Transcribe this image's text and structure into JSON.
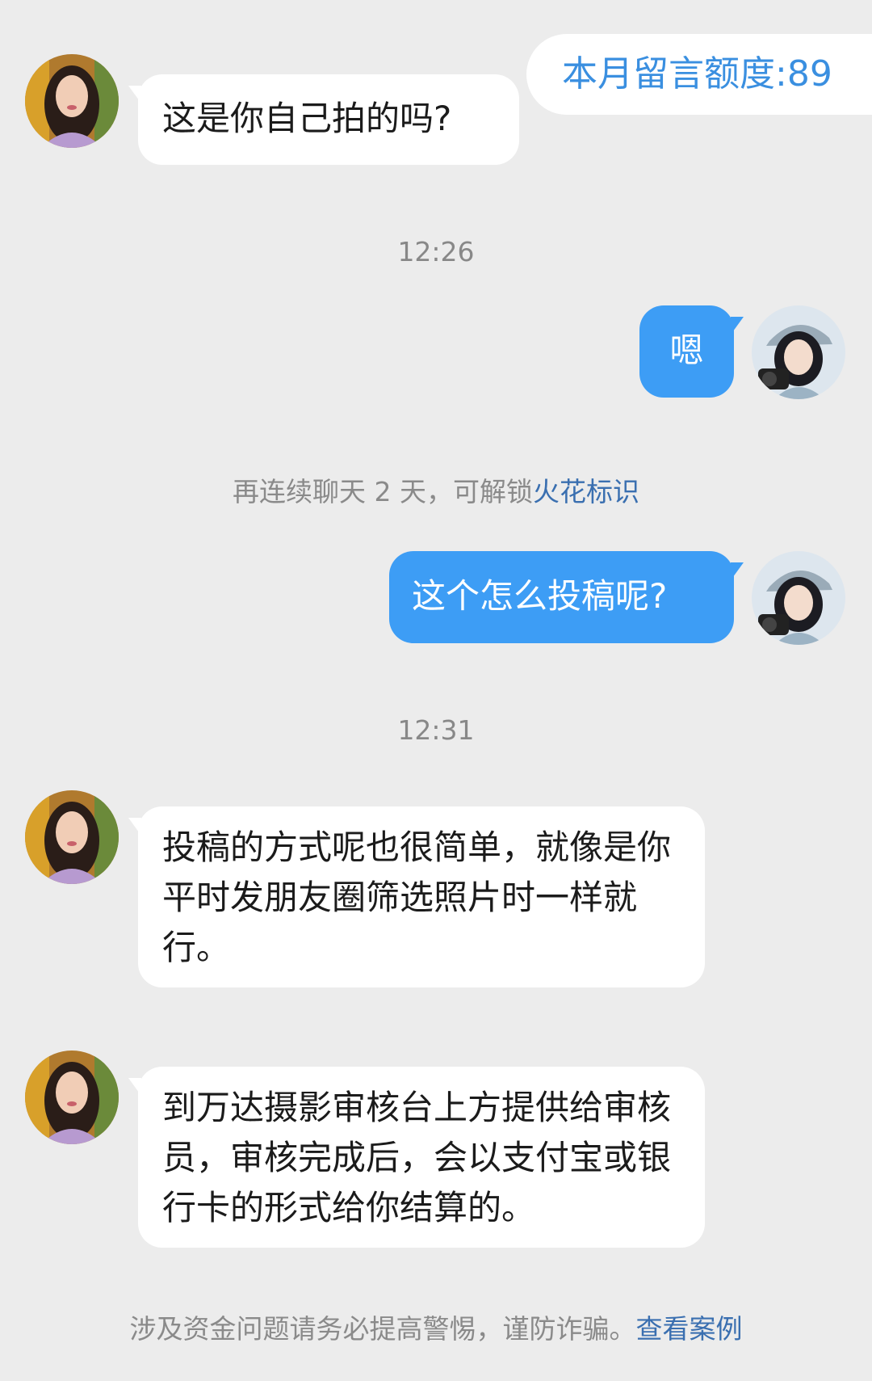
{
  "quota": {
    "label": "本月留言额度:89"
  },
  "messages": [
    {
      "side": "left",
      "text": "这是你自己拍的吗?"
    },
    {
      "side": "right",
      "text": "嗯"
    },
    {
      "side": "right",
      "text": "这个怎么投稿呢?"
    },
    {
      "side": "left",
      "text": "投稿的方式呢也很简单，就像是你平时发朋友圈筛选照片时一样就行。"
    },
    {
      "side": "left",
      "text": "到万达摄影审核台上方提供给审核员，审核完成后，会以支付宝或银行卡的形式给你结算的。"
    }
  ],
  "times": [
    "12:26",
    "12:31"
  ],
  "spark_notice": {
    "text": "再连续聊天 2 天，可解锁",
    "link": "火花标识"
  },
  "fraud_notice": {
    "text": "涉及资金问题请务必提高警惕，谨防诈骗。",
    "link": "查看案例"
  },
  "colors": {
    "background": "#ececec",
    "sent_bubble": "#3d9df5",
    "received_bubble": "#ffffff",
    "link": "#3a6fb0",
    "quota_text": "#3a8fe0"
  }
}
